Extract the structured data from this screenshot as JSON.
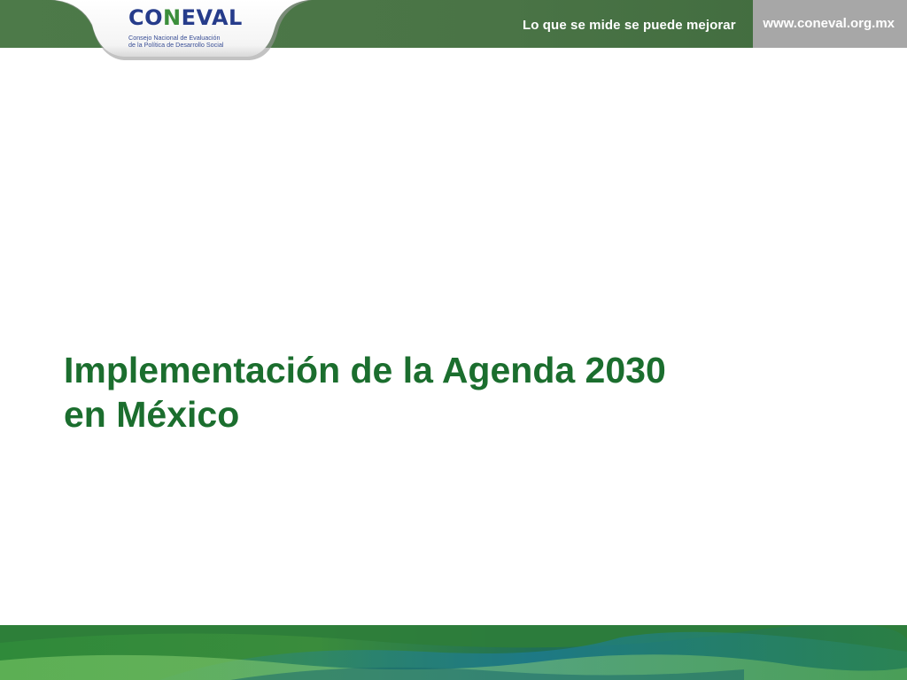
{
  "header": {
    "tagline": "Lo que se mide se puede mejorar",
    "website": "www.coneval.org.mx"
  },
  "logo": {
    "name": "CONEVAL",
    "name_parts": [
      "CO",
      "N",
      "EVAL"
    ],
    "subtitle_line1": "Consejo Nacional de Evaluación",
    "subtitle_line2": "de la Política de Desarrollo Social"
  },
  "slide": {
    "title_line1": "Implementación de la Agenda 2030",
    "title_line2": "en México"
  },
  "colors": {
    "header_green": "#4a7446",
    "header_gray": "#a7a7a7",
    "title_green": "#1b6e2e",
    "logo_blue": "#263c8b",
    "logo_green": "#3b8e3b"
  }
}
